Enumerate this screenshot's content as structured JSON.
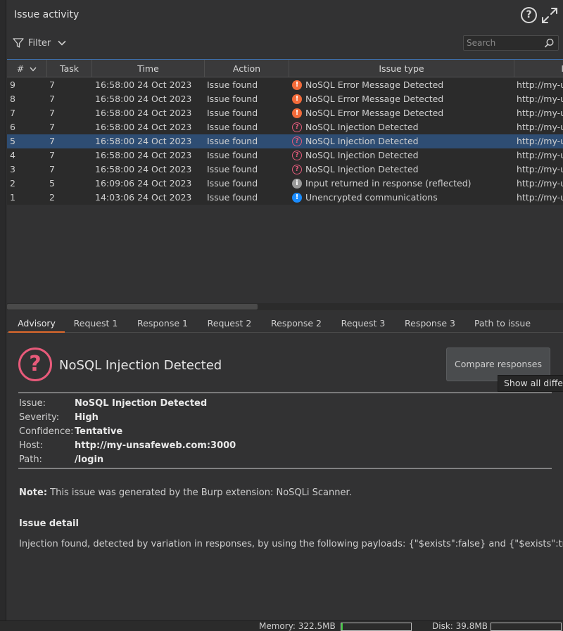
{
  "header": {
    "title": "Issue activity",
    "filter_label": "Filter",
    "search_placeholder": "Search"
  },
  "columns": [
    "#",
    "Task",
    "Time",
    "Action",
    "Issue type",
    "I"
  ],
  "rows": [
    {
      "num": "9",
      "task": "7",
      "time": "16:58:00 24 Oct 2023",
      "action": "Issue found",
      "severity": "high",
      "issue": "NoSQL Error Message Detected",
      "url": "http://my-u"
    },
    {
      "num": "8",
      "task": "7",
      "time": "16:58:00 24 Oct 2023",
      "action": "Issue found",
      "severity": "high",
      "issue": "NoSQL Error Message Detected",
      "url": "http://my-u"
    },
    {
      "num": "7",
      "task": "7",
      "time": "16:58:00 24 Oct 2023",
      "action": "Issue found",
      "severity": "high",
      "issue": "NoSQL Error Message Detected",
      "url": "http://my-u"
    },
    {
      "num": "6",
      "task": "7",
      "time": "16:58:00 24 Oct 2023",
      "action": "Issue found",
      "severity": "tentative",
      "issue": "NoSQL Injection Detected",
      "url": "http://my-u"
    },
    {
      "num": "5",
      "task": "7",
      "time": "16:58:00 24 Oct 2023",
      "action": "Issue found",
      "severity": "tentative",
      "issue": "NoSQL Injection Detected",
      "url": "http://my-u",
      "selected": true
    },
    {
      "num": "4",
      "task": "7",
      "time": "16:58:00 24 Oct 2023",
      "action": "Issue found",
      "severity": "tentative",
      "issue": "NoSQL Injection Detected",
      "url": "http://my-u"
    },
    {
      "num": "3",
      "task": "7",
      "time": "16:58:00 24 Oct 2023",
      "action": "Issue found",
      "severity": "tentative",
      "issue": "NoSQL Injection Detected",
      "url": "http://my-u"
    },
    {
      "num": "2",
      "task": "5",
      "time": "16:09:06 24 Oct 2023",
      "action": "Issue found",
      "severity": "info",
      "issue": "Input returned in response (reflected)",
      "url": "http://my-u"
    },
    {
      "num": "1",
      "task": "2",
      "time": "14:03:06 24 Oct 2023",
      "action": "Issue found",
      "severity": "info-blue",
      "issue": "Unencrypted communications",
      "url": "http://my-u"
    }
  ],
  "tabs": [
    "Advisory",
    "Request 1",
    "Response 1",
    "Request 2",
    "Response 2",
    "Request 3",
    "Response 3",
    "Path to issue"
  ],
  "advisory": {
    "title": "NoSQL Injection Detected",
    "compare_button": "Compare responses",
    "tooltip": "Show all differe",
    "fields": [
      {
        "key": "Issue:",
        "value": "NoSQL Injection Detected"
      },
      {
        "key": "Severity:",
        "value": "High"
      },
      {
        "key": "Confidence:",
        "value": "Tentative"
      },
      {
        "key": "Host:",
        "value": "http://my-unsafeweb.com:3000"
      },
      {
        "key": "Path:",
        "value": "/login"
      }
    ],
    "note_label": "Note:",
    "note_text": " This issue was generated by the Burp extension: NoSQLi Scanner.",
    "detail_heading": "Issue detail",
    "detail_text": "Injection found, detected by variation in responses, by using the following payloads: {\"$exists\":false} and {\"$exists\":true}"
  },
  "status": {
    "memory_label": "Memory: 322.5MB",
    "memory_fill": 0.02,
    "disk_label": "Disk: 39.8MB",
    "disk_fill": 0.0
  },
  "colors": {
    "selection": "#2e4d73",
    "high": "#f26b3a",
    "tentative": "#e05a7a",
    "info": "#9a9a9a",
    "info_blue": "#1a8cff",
    "tab_accent": "#e06a2c",
    "memory_bar": "#3cc23c"
  },
  "icons": {
    "help": "help-circle-icon",
    "expand": "expand-arrows-icon",
    "filter": "funnel-icon",
    "search": "magnifier-icon"
  }
}
